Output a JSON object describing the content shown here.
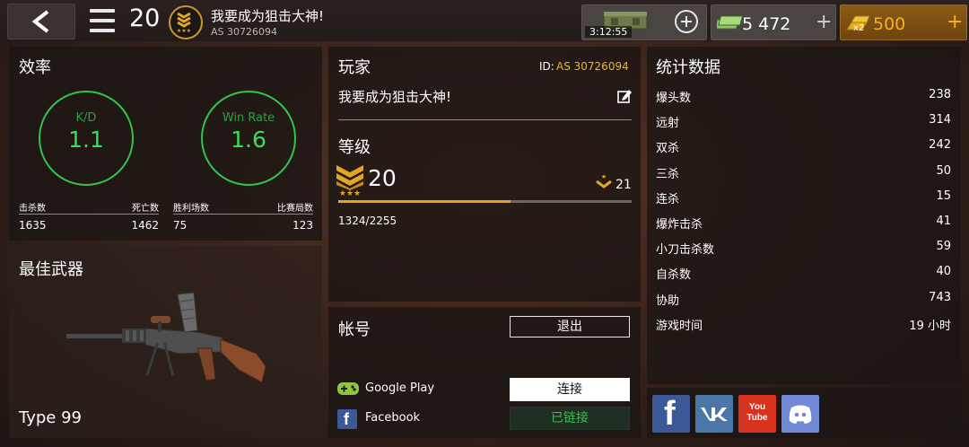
{
  "topbar": {
    "player_level": "20",
    "player_name": "我要成为狙击大神!",
    "player_tag": "AS 30726094",
    "crate_timer": "3:12:55",
    "cash_amount": "5 472",
    "gold_amount": "500",
    "gold_multiplier": "x2",
    "plus_sign": "+"
  },
  "efficiency": {
    "title": "效率",
    "kd_label": "K/D",
    "kd_value": "1.1",
    "winrate_label": "Win Rate",
    "winrate_value": "1.6",
    "kills_label": "击杀数",
    "kills_value": "1635",
    "deaths_label": "死亡数",
    "deaths_value": "1462",
    "wins_label": "胜利场数",
    "wins_value": "75",
    "matches_label": "比赛局数",
    "matches_value": "123"
  },
  "best_weapon": {
    "title": "最佳武器",
    "name": "Type 99"
  },
  "player": {
    "title": "玩家",
    "id_label": "ID:",
    "id_value": "AS 30726094",
    "name": "我要成为狙击大神!",
    "level_title": "等级",
    "level": "20",
    "next_level": "21",
    "xp_text": "1324/2255",
    "xp_progress": 0.587
  },
  "account": {
    "title": "帐号",
    "logout_label": "退出",
    "google_label": "Google Play",
    "google_btn": "连接",
    "facebook_label": "Facebook",
    "facebook_btn": "已链接"
  },
  "statistics": {
    "title": "统计数据",
    "rows": [
      {
        "label": "爆头数",
        "value": "238"
      },
      {
        "label": "远射",
        "value": "314"
      },
      {
        "label": "双杀",
        "value": "242"
      },
      {
        "label": "三杀",
        "value": "50"
      },
      {
        "label": "连杀",
        "value": "15"
      },
      {
        "label": "爆炸击杀",
        "value": "41"
      },
      {
        "label": "小刀击杀数",
        "value": "59"
      },
      {
        "label": "自杀数",
        "value": "40"
      },
      {
        "label": "协助",
        "value": "743"
      },
      {
        "label": "游戏时间",
        "value": "19 小时"
      }
    ]
  },
  "social": {
    "youtube_text": "You Tube",
    "icons": [
      "facebook-icon",
      "vk-icon",
      "youtube-icon",
      "discord-icon"
    ]
  },
  "colors": {
    "accent_gold": "#f0a020",
    "ring_green": "#33c24b",
    "id_yellow": "#f2b51f"
  }
}
